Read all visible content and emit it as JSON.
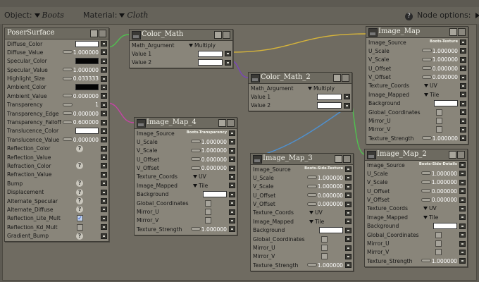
{
  "toolbar": {
    "object_label": "Object:",
    "object_value": "Boots",
    "material_label": "Material:",
    "material_value": "Cloth",
    "help_icon": "question-mark-icon",
    "node_options_label": "Node options:",
    "node_options_icon": "triangle-right-icon"
  },
  "colors": {
    "wire_yellow": "#d6b43a",
    "wire_green": "#4fc24f",
    "wire_purple": "#7a45b8",
    "wire_magenta": "#c644a6",
    "wire_blue": "#4f90cf"
  },
  "nodes": {
    "poser": {
      "title": "PoserSurface",
      "rows": [
        {
          "label": "Diffuse_Color"
        },
        {
          "label": "Diffuse_Value",
          "value": "1.000000"
        },
        {
          "label": "Specular_Color"
        },
        {
          "label": "Specular_Value",
          "value": "1.000000"
        },
        {
          "label": "Highlight_Size",
          "value": "0.033333"
        },
        {
          "label": "Ambient_Color"
        },
        {
          "label": "Ambient_Value",
          "value": "0.000000"
        },
        {
          "label": "Transparency",
          "value": "1"
        },
        {
          "label": "Transparency_Edge",
          "value": "0.000000"
        },
        {
          "label": "Transparency_Falloff",
          "value": "0.600000"
        },
        {
          "label": "Translucence_Color"
        },
        {
          "label": "Translucence_Value",
          "value": "0.000000"
        },
        {
          "label": "Reflection_Color"
        },
        {
          "label": "Reflection_Value"
        },
        {
          "label": "Refraction_Color"
        },
        {
          "label": "Refraction_Value"
        },
        {
          "label": "Bump"
        },
        {
          "label": "Displacement"
        },
        {
          "label": "Alternate_Specular"
        },
        {
          "label": "Alternate_Diffuse"
        },
        {
          "label": "Reflection_Lite_Mult"
        },
        {
          "label": "Reflection_Kd_Mult"
        },
        {
          "label": "Gradient_Bump"
        }
      ]
    },
    "color_math": {
      "title": "Color_Math",
      "rows": [
        {
          "label": "Math_Argument",
          "value": "Multiply"
        },
        {
          "label": "Value 1"
        },
        {
          "label": "Value 2"
        }
      ]
    },
    "color_math_2": {
      "title": "Color_Math_2",
      "rows": [
        {
          "label": "Math_Argument",
          "value": "Multiply"
        },
        {
          "label": "Value 1"
        },
        {
          "label": "Value 2"
        }
      ]
    },
    "image_map": {
      "title": "Image_Map",
      "rows": [
        {
          "label": "Image_Source",
          "value": "Boots-Texture"
        },
        {
          "label": "U_Scale",
          "value": "1.000000"
        },
        {
          "label": "V_Scale",
          "value": "1.000000"
        },
        {
          "label": "U_Offset",
          "value": "0.000000"
        },
        {
          "label": "V_Offset",
          "value": "0.000000"
        },
        {
          "label": "Texture_Coords",
          "value": "UV"
        },
        {
          "label": "Image_Mapped",
          "value": "Tile"
        },
        {
          "label": "Background"
        },
        {
          "label": "Global_Coordinates"
        },
        {
          "label": "Mirror_U"
        },
        {
          "label": "Mirror_V"
        },
        {
          "label": "Texture_Strength",
          "value": "1.000000"
        }
      ]
    },
    "image_map_4": {
      "title": "Image_Map_4",
      "rows": [
        {
          "label": "Image_Source",
          "value": "Boots-Transparency"
        },
        {
          "label": "U_Scale",
          "value": "1.000000"
        },
        {
          "label": "V_Scale",
          "value": "1.000000"
        },
        {
          "label": "U_Offset",
          "value": "0.000000"
        },
        {
          "label": "V_Offset",
          "value": "0.000000"
        },
        {
          "label": "Texture_Coords",
          "value": "UV"
        },
        {
          "label": "Image_Mapped",
          "value": "Tile"
        },
        {
          "label": "Background"
        },
        {
          "label": "Global_Coordinates"
        },
        {
          "label": "Mirror_U"
        },
        {
          "label": "Mirror_V"
        },
        {
          "label": "Texture_Strength",
          "value": "1.000000"
        }
      ]
    },
    "image_map_3": {
      "title": "Image_Map_3",
      "rows": [
        {
          "label": "Image_Source",
          "value": "Boots-Side-Texture"
        },
        {
          "label": "U_Scale",
          "value": "1.000000"
        },
        {
          "label": "V_Scale",
          "value": "1.000000"
        },
        {
          "label": "U_Offset",
          "value": "0.000000"
        },
        {
          "label": "V_Offset",
          "value": "0.000000"
        },
        {
          "label": "Texture_Coords",
          "value": "UV"
        },
        {
          "label": "Image_Mapped",
          "value": "Tile"
        },
        {
          "label": "Background"
        },
        {
          "label": "Global_Coordinates"
        },
        {
          "label": "Mirror_U"
        },
        {
          "label": "Mirror_V"
        },
        {
          "label": "Texture_Strength",
          "value": "1.000000"
        }
      ]
    },
    "image_map_2": {
      "title": "Image_Map_2",
      "rows": [
        {
          "label": "Image_Source",
          "value": "Boots-Side-Details"
        },
        {
          "label": "U_Scale",
          "value": "1.000000"
        },
        {
          "label": "V_Scale",
          "value": "1.000000"
        },
        {
          "label": "U_Offset",
          "value": "0.000000"
        },
        {
          "label": "V_Offset",
          "value": "0.000000"
        },
        {
          "label": "Texture_Coords",
          "value": "UV"
        },
        {
          "label": "Image_Mapped",
          "value": "Tile"
        },
        {
          "label": "Background"
        },
        {
          "label": "Global_Coordinates"
        },
        {
          "label": "Mirror_U"
        },
        {
          "label": "Mirror_V"
        },
        {
          "label": "Texture_Strength",
          "value": "1.000000"
        }
      ]
    }
  }
}
